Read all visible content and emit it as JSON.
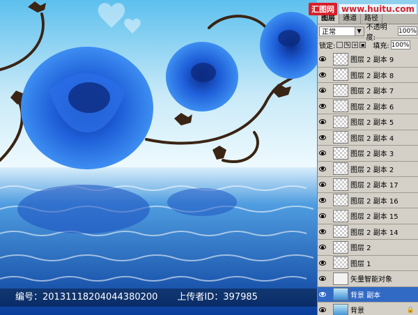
{
  "watermark": {
    "brand": "汇图网",
    "url": "www.huitu.com"
  },
  "caption": {
    "id_label": "编号：20131118204044380200",
    "uploader_label": "上传者ID：397985"
  },
  "panel": {
    "tabs": [
      "图层",
      "通道",
      "路径"
    ],
    "blend_mode": "正常",
    "opacity_label": "不透明度:",
    "opacity_value": "100%",
    "lock_label": "锁定:",
    "fill_label": "填充:",
    "fill_value": "100%",
    "layers": [
      {
        "name": "图层 2 副本 9",
        "thumb": "transparent"
      },
      {
        "name": "图层 2 副本 8",
        "thumb": "transparent"
      },
      {
        "name": "图层 2 副本 7",
        "thumb": "transparent"
      },
      {
        "name": "图层 2 副本 6",
        "thumb": "transparent"
      },
      {
        "name": "图层 2 副本 5",
        "thumb": "transparent"
      },
      {
        "name": "图层 2 副本 4",
        "thumb": "transparent"
      },
      {
        "name": "图层 2 副本 3",
        "thumb": "transparent"
      },
      {
        "name": "图层 2 副本 2",
        "thumb": "transparent"
      },
      {
        "name": "图层 2 副本 17",
        "thumb": "transparent"
      },
      {
        "name": "图层 2 副本 16",
        "thumb": "transparent"
      },
      {
        "name": "图层 2 副本 15",
        "thumb": "transparent"
      },
      {
        "name": "图层 2 副本 14",
        "thumb": "transparent"
      },
      {
        "name": "图层 2",
        "thumb": "transparent"
      },
      {
        "name": "图层 1",
        "thumb": "transparent"
      },
      {
        "name": "矢量智能对象",
        "thumb": "smart"
      },
      {
        "name": "背景 副本",
        "thumb": "bg",
        "selected": true
      },
      {
        "name": "背景",
        "thumb": "bg",
        "locked": true
      }
    ]
  }
}
